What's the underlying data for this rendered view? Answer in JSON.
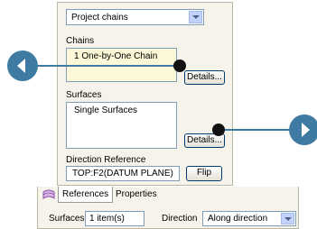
{
  "panel": {
    "type_select": "Project chains",
    "chains_label": "Chains",
    "chains_items": [
      "1 One-by-One Chain"
    ],
    "chains_details_label": "Details...",
    "surfaces_label": "Surfaces",
    "surfaces_items": [
      "Single Surfaces"
    ],
    "surfaces_details_label": "Details...",
    "direction_reference_label": "Direction Reference",
    "direction_reference_value": "TOP:F2(DATUM PLANE)",
    "flip_label": "Flip"
  },
  "tabs": {
    "references_label": "References",
    "properties_label": "Properties"
  },
  "bottom_bar": {
    "surfaces_label": "Surfaces",
    "surfaces_value": "1 item(s)",
    "direction_label": "Direction",
    "direction_value": "Along direction"
  },
  "colors": {
    "callout": "#3f7aa3",
    "panel_bg": "#f6f4ea",
    "chains_list_bg": "#fbf8d8"
  }
}
